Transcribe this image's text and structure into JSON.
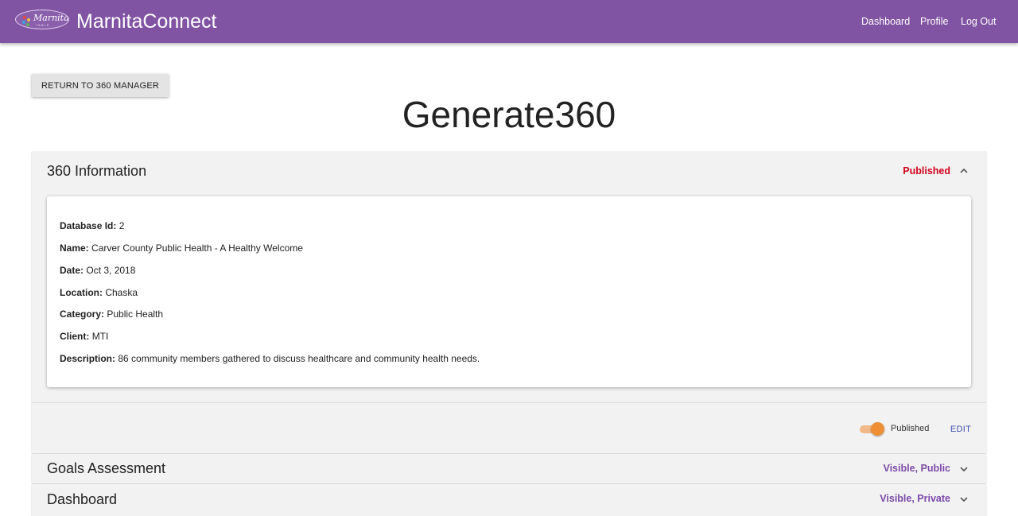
{
  "header": {
    "logo_text": "Marnita's",
    "logo_subtext": "TABLE",
    "brand": "MarnitaConnect",
    "nav": [
      "Dashboard",
      "Profile",
      "Log Out"
    ]
  },
  "return_button": "RETURN TO 360 MANAGER",
  "page_title": "Generate360",
  "info_panel": {
    "title": "360 Information",
    "status": "Published",
    "status_color": "#d0021b",
    "fields": [
      {
        "label": "Database Id:",
        "value": "2"
      },
      {
        "label": "Name:",
        "value": "Carver County Public Health - A Healthy Welcome"
      },
      {
        "label": "Date:",
        "value": "Oct 3, 2018"
      },
      {
        "label": "Location:",
        "value": "Chaska"
      },
      {
        "label": "Category:",
        "value": "Public Health"
      },
      {
        "label": "Client:",
        "value": "MTI"
      },
      {
        "label": "Description:",
        "value": "86 community members gathered to discuss healthcare and community health needs."
      }
    ],
    "toggle_label": "Published",
    "toggle_on": true,
    "edit_label": "EDIT"
  },
  "goals_panel": {
    "title": "Goals Assessment",
    "status": "Visible, Public",
    "status_color": "#7b4aa8"
  },
  "dashboard_panel": {
    "title": "Dashboard",
    "status": "Visible, Private",
    "status_color": "#7b4aa8"
  },
  "colors": {
    "appbar": "#8053a3",
    "toggle_accent": "#ee8f35",
    "link_blue": "#3f51b5"
  },
  "icons": [
    "logo",
    "chevron-up-icon",
    "chevron-down-icon"
  ]
}
